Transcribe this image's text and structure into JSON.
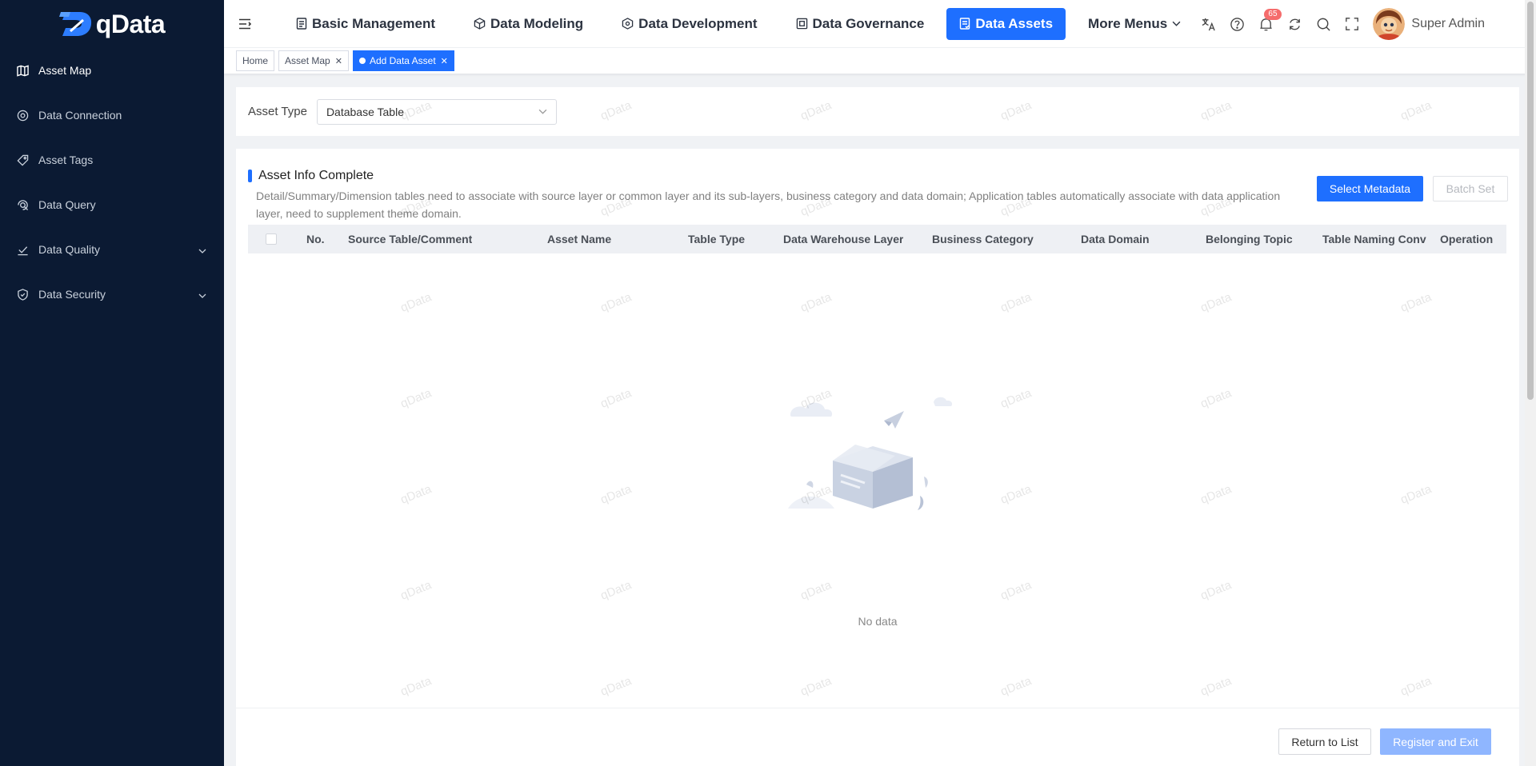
{
  "app": {
    "logo_text": "qData"
  },
  "sidebar": {
    "items": [
      {
        "label": "Asset Map",
        "icon": "map-icon",
        "active": true
      },
      {
        "label": "Data Connection",
        "icon": "connection-icon"
      },
      {
        "label": "Asset Tags",
        "icon": "tag-icon"
      },
      {
        "label": "Data Query",
        "icon": "query-icon"
      },
      {
        "label": "Data Quality",
        "icon": "quality-icon",
        "expandable": true
      },
      {
        "label": "Data Security",
        "icon": "shield-icon",
        "expandable": true
      }
    ]
  },
  "header": {
    "nav": [
      {
        "label": "Basic Management",
        "icon": "doc-icon"
      },
      {
        "label": "Data Modeling",
        "icon": "cube-icon"
      },
      {
        "label": "Data Development",
        "icon": "hexagon-icon"
      },
      {
        "label": "Data Governance",
        "icon": "chip-icon"
      },
      {
        "label": "Data Assets",
        "icon": "assets-icon",
        "active": true
      },
      {
        "label": "More Menus",
        "icon": "chevron-down-icon"
      }
    ],
    "notification_count": "65",
    "username": "Super Admin"
  },
  "tabs": [
    {
      "label": "Home"
    },
    {
      "label": "Asset Map",
      "closable": true
    },
    {
      "label": "Add Data Asset",
      "closable": true,
      "active": true
    }
  ],
  "form": {
    "asset_type_label": "Asset Type",
    "asset_type_value": "Database Table"
  },
  "section": {
    "title": "Asset Info Complete",
    "description": "Detail/Summary/Dimension tables need to associate with source layer or common layer and its sub-layers, business category and data domain; Application tables automatically associate with data application layer, need to supplement theme domain.",
    "select_metadata_button": "Select Metadata",
    "batch_set_button": "Batch Set"
  },
  "table": {
    "columns": [
      "No.",
      "Source Table/Comment",
      "Asset Name",
      "Table Type",
      "Data Warehouse Layer",
      "Business Category",
      "Data Domain",
      "Belonging Topic",
      "Table Naming Conv",
      "Operation"
    ],
    "empty_text": "No data"
  },
  "footer": {
    "return_button": "Return to List",
    "register_button": "Register and Exit"
  },
  "watermark_text": "qData",
  "colors": {
    "primary": "#1e6fff",
    "sidebar_bg": "#0b1a33",
    "badge": "#f56c6c"
  }
}
